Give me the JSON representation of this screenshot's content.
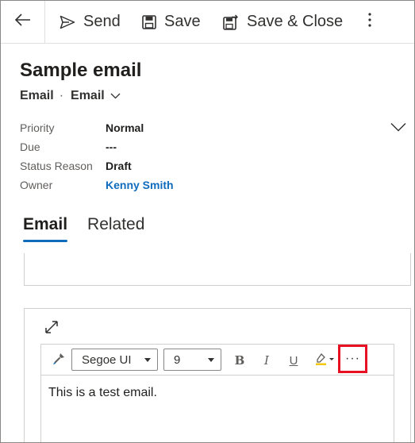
{
  "command_bar": {
    "send_label": "Send",
    "save_label": "Save",
    "save_close_label": "Save & Close"
  },
  "header": {
    "title": "Sample email",
    "entity": "Email",
    "separator": "·",
    "form_selector": "Email"
  },
  "fields": [
    {
      "label": "Priority",
      "value": "Normal"
    },
    {
      "label": "Due",
      "value": "---"
    },
    {
      "label": "Status Reason",
      "value": "Draft"
    },
    {
      "label": "Owner",
      "value": "Kenny Smith"
    }
  ],
  "tabs": [
    {
      "label": "Email",
      "active": true
    },
    {
      "label": "Related",
      "active": false
    }
  ],
  "editor": {
    "font_family_value": "Segoe UI",
    "font_size_value": "9",
    "bold_label": "B",
    "italic_label": "I",
    "underline_label": "U",
    "more_label": "···",
    "content": "This is a test email."
  },
  "colors": {
    "accent": "#0f6cbd",
    "highlight_box": "#e81123",
    "link": "#0f6cbd"
  }
}
